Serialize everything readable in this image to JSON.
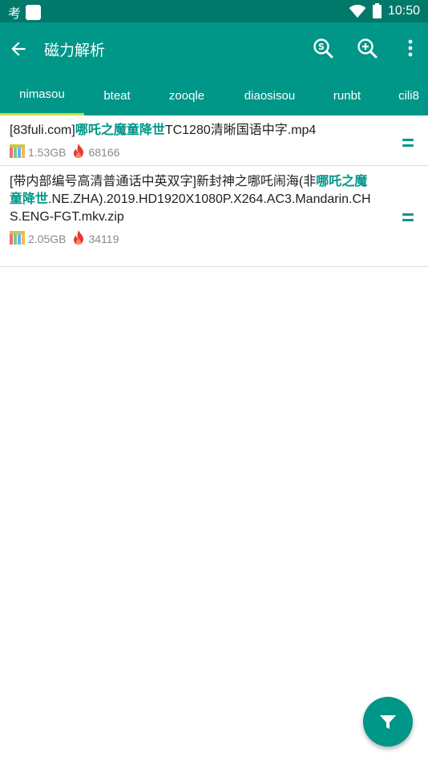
{
  "status_bar": {
    "carrier_glyph": "考",
    "time": "10:50",
    "icons": [
      "notification-icon",
      "wifi-icon",
      "battery-icon"
    ]
  },
  "app_bar": {
    "title": "磁力解析",
    "icons": [
      "back-arrow-icon",
      "search-s-icon",
      "search-plus-icon",
      "more-vert-icon"
    ]
  },
  "tabs": [
    {
      "label": "nimasou",
      "active": true
    },
    {
      "label": "bteat",
      "active": false
    },
    {
      "label": "zooqle",
      "active": false
    },
    {
      "label": "diaosisou",
      "active": false
    },
    {
      "label": "runbt",
      "active": false
    },
    {
      "label": "cili8",
      "active": false
    }
  ],
  "results": [
    {
      "name_prefix": "[83fuli.com]",
      "name_highlight": "哪吒之魔童降世",
      "name_suffix": "TC1280清晰国语中字.mp4",
      "size": "1.53GB",
      "hot": "68166"
    },
    {
      "name_prefix": "[带内部编号高清普通话中英双字]新封神之哪吒闹海(非",
      "name_highlight": "哪吒之魔童降世",
      "name_suffix": ".NE.ZHA).2019.HD1920X1080P.X264.AC3.Mandarin.CHS.ENG-FGT.mkv.zip",
      "size": "2.05GB",
      "hot": "34119"
    }
  ],
  "colors": {
    "status_bar": "#00796b",
    "primary": "#009688",
    "tab_indicator": "#cddc39",
    "meta_text": "#8a8a8a",
    "hot_icon": "#e53935"
  },
  "fab": {
    "icon": "filter-icon"
  }
}
